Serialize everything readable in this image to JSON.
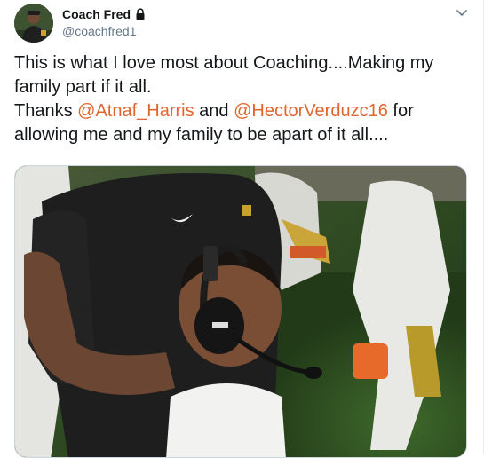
{
  "user": {
    "display_name": "Coach Fred",
    "handle": "@coachfred1",
    "protected_icon": "lock-icon",
    "avatar_icon": "avatar"
  },
  "menu": {
    "caret_icon": "chevron-down-icon"
  },
  "tweet": {
    "line1": "This is what I love most about Coaching....Making my",
    "line2": "family part if it all.",
    "line3_before": "Thanks ",
    "mention1": "@Atnaf_Harris",
    "line3_mid": " and ",
    "mention2": "@HectorVerduzc16",
    "line3_after": " for",
    "line4": "allowing me and my family to be apart of it all...."
  },
  "colors": {
    "mention": "#e0652e",
    "text": "#14171a",
    "secondary": "#657786"
  },
  "media": {
    "type": "photo"
  }
}
